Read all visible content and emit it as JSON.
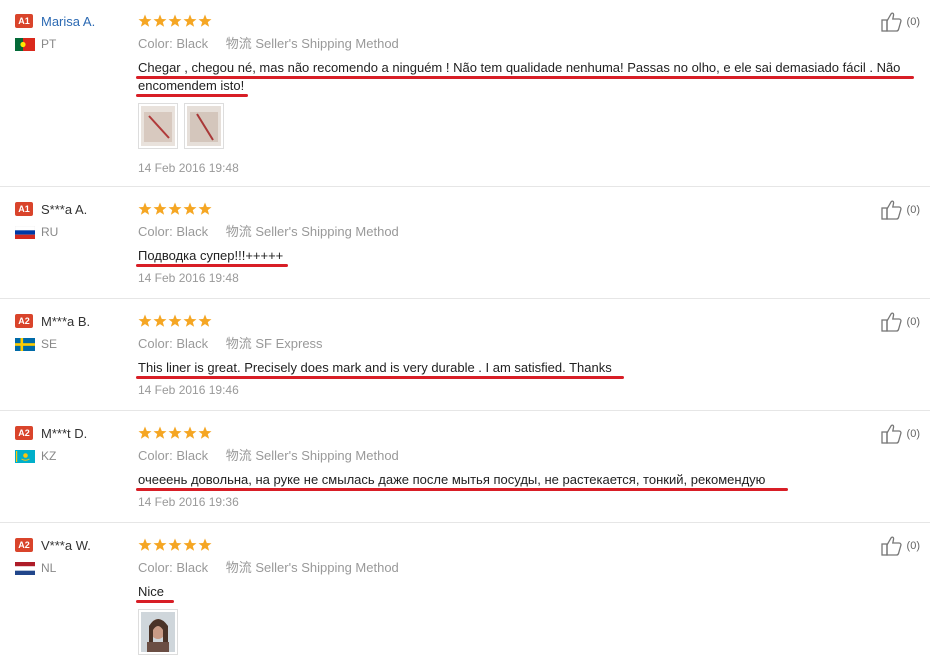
{
  "colors": {
    "accent": "#d9442b",
    "star": "#f5a623",
    "underline": "#d81e26",
    "link": "#2c6ab3"
  },
  "reviews": [
    {
      "level": "A1",
      "name": "Marisa A.",
      "country": "PT",
      "flag": "pt-flag-icon",
      "rating": 5,
      "color_label": "Color:",
      "color_value": "Black",
      "shipping_label": "物流",
      "shipping_value": "Seller's Shipping Method",
      "text_line1": "Chegar , chegou né, mas não recomendo a ninguém ! Não tem qualidade nenhuma! Passas no olho, e ele sai demasiado fácil . Não",
      "text_line2": "encomendem isto!",
      "images": 2,
      "date": "14 Feb 2016 19:48",
      "helpful_count": "(0)"
    },
    {
      "level": "A1",
      "name": "S***a A.",
      "country": "RU",
      "flag": "ru-flag-icon",
      "rating": 5,
      "color_label": "Color:",
      "color_value": "Black",
      "shipping_label": "物流",
      "shipping_value": "Seller's Shipping Method",
      "text_line1": "Подводка супер!!!+++++",
      "date": "14 Feb 2016 19:48",
      "helpful_count": "(0)"
    },
    {
      "level": "A2",
      "name": "M***a B.",
      "country": "SE",
      "flag": "se-flag-icon",
      "rating": 5,
      "color_label": "Color:",
      "color_value": "Black",
      "shipping_label": "物流",
      "shipping_value": "SF Express",
      "text_line1": "This liner is great. Precisely does mark and is very durable . I am satisfied. Thanks",
      "date": "14 Feb 2016 19:46",
      "helpful_count": "(0)"
    },
    {
      "level": "A2",
      "name": "M***t D.",
      "country": "KZ",
      "flag": "kz-flag-icon",
      "rating": 5,
      "color_label": "Color:",
      "color_value": "Black",
      "shipping_label": "物流",
      "shipping_value": "Seller's Shipping Method",
      "text_line1": "очееень довольна, на руке не смылась даже после мытья посуды, не растекается, тонкий, рекомендую",
      "date": "14 Feb 2016 19:36",
      "helpful_count": "(0)"
    },
    {
      "level": "A2",
      "name": "V***a W.",
      "country": "NL",
      "flag": "nl-flag-icon",
      "rating": 5,
      "color_label": "Color:",
      "color_value": "Black",
      "shipping_label": "物流",
      "shipping_value": "Seller's Shipping Method",
      "text_line1": "Nice",
      "images": 1,
      "helpful_count": "(0)"
    }
  ]
}
